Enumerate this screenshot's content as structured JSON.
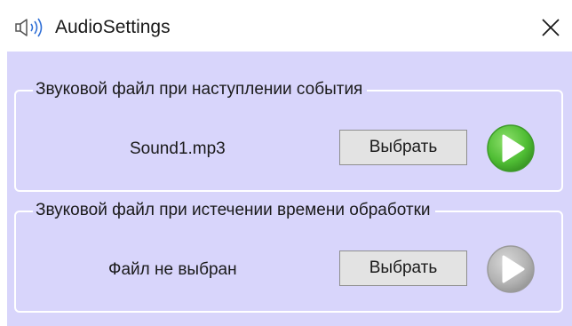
{
  "window": {
    "title": "AudioSettings",
    "app_icon": "speaker-icon",
    "close_icon": "close-icon"
  },
  "event_sound": {
    "legend": "Звуковой файл при наступлении события",
    "file_name": "Sound1.mp3",
    "choose_label": "Выбрать",
    "play_icon": "play-icon",
    "play_enabled": true,
    "play_color": "#5ec443"
  },
  "timeout_sound": {
    "legend": "Звуковой файл при истечении времени обработки",
    "file_name": "Файл не выбран",
    "choose_label": "Выбрать",
    "play_icon": "play-icon",
    "play_enabled": false,
    "play_color": "#b5b5b5"
  },
  "colors": {
    "panel_background": "#d8d5fb",
    "titlebar_background": "#ffffff",
    "button_background": "#e3e3e3"
  }
}
